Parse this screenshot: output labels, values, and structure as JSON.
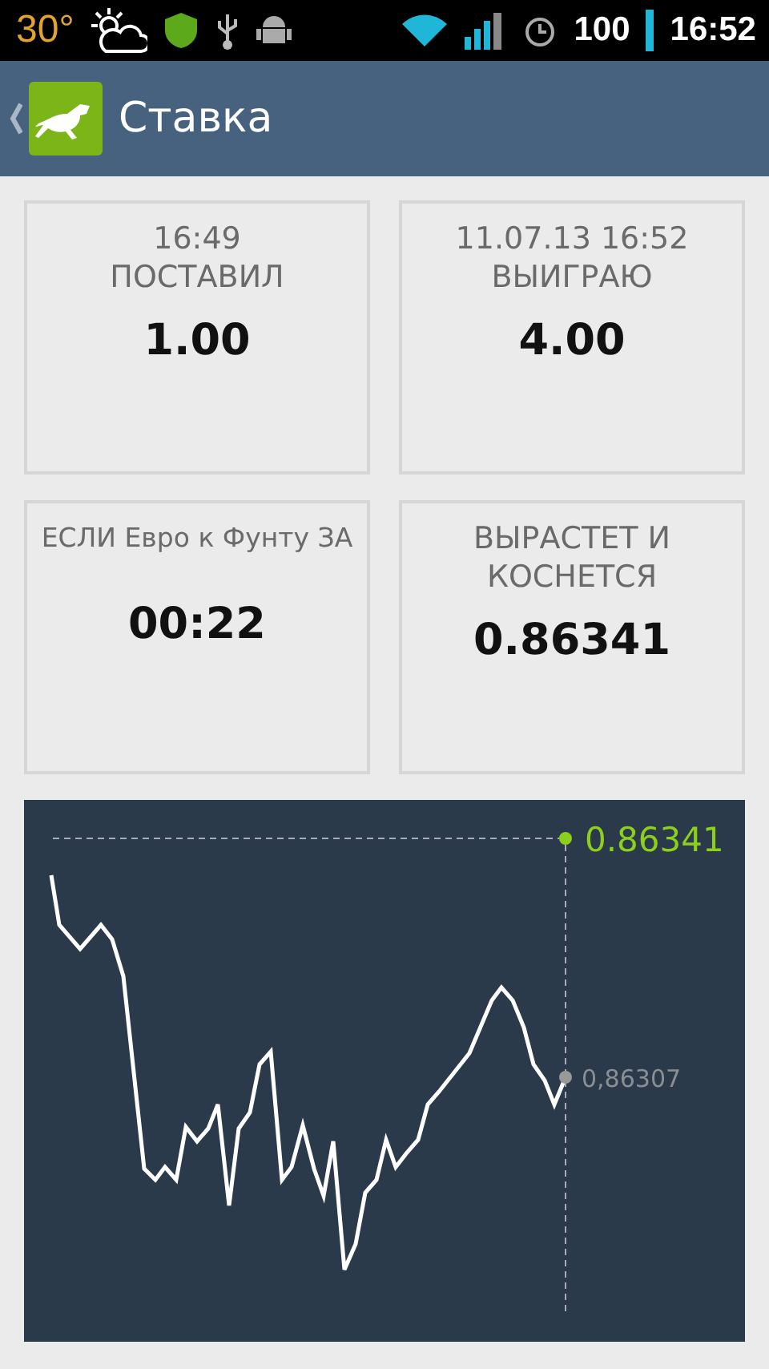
{
  "status_bar": {
    "temperature": "30°",
    "battery": "100",
    "time": "16:52"
  },
  "app_bar": {
    "title": "Ставка"
  },
  "cards": [
    {
      "labels": [
        "16:49",
        "ПОСТАВИЛ"
      ],
      "value": "1.00"
    },
    {
      "labels": [
        "11.07.13 16:52",
        "ВЫИГРАЮ"
      ],
      "value": "4.00"
    },
    {
      "labels": [
        "ЕСЛИ Евро к Фунту ЗА"
      ],
      "value": "00:22"
    },
    {
      "labels": [
        "ВЫРАСТЕТ И КОСНЕТСЯ"
      ],
      "value": "0.86341"
    }
  ],
  "chart": {
    "target_label": "0.86341",
    "current_label": "0,86307"
  }
}
